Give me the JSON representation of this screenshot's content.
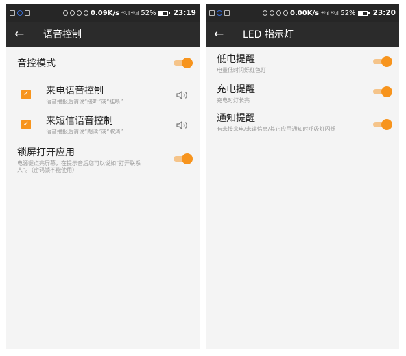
{
  "left": {
    "status_bar": {
      "speed": "0.09K/s",
      "signal": "⁴ᴳ.ıl ⁴ᴳ.ıl",
      "battery": "52%",
      "battery_level": 0.52,
      "time": "23:19"
    },
    "toolbar": {
      "back_icon": "←",
      "title": "语音控制"
    },
    "voice_mode": {
      "title": "音控模式",
      "enabled": true
    },
    "call_voice": {
      "title": "来电语音控制",
      "subtitle": "语音播报后请说“接听”或“挂断”",
      "checked": true
    },
    "sms_voice": {
      "title": "来短信语音控制",
      "subtitle": "语音播报后请说“朗读”或“取消”",
      "checked": true
    },
    "lock_open": {
      "title": "锁屏打开应用",
      "subtitle": "电源键点亮屏幕，在提示音后您可以说如“打开联系人”。（密码锁不能使用）",
      "enabled": true
    }
  },
  "right": {
    "status_bar": {
      "speed": "0.00K/s",
      "signal": "⁴ᴳ.ıl ⁴ᴳ.ıl",
      "battery": "52%",
      "battery_level": 0.52,
      "time": "23:20"
    },
    "toolbar": {
      "back_icon": "←",
      "title": "LED 指示灯"
    },
    "low_battery": {
      "title": "低电提醒",
      "subtitle": "电量低时闪烁红色灯",
      "enabled": true
    },
    "charging": {
      "title": "充电提醒",
      "subtitle": "充电时灯长亮",
      "enabled": true
    },
    "notify": {
      "title": "通知提醒",
      "subtitle": "有未接来电/未读信息/其它应用通知时呼吸灯闪烁",
      "enabled": true
    }
  },
  "colors": {
    "accent": "#f7941d",
    "accent_light": "#f5c48a",
    "toolbar": "#2b2b2b",
    "statusbar": "#262626",
    "background": "#f4f4f4"
  }
}
